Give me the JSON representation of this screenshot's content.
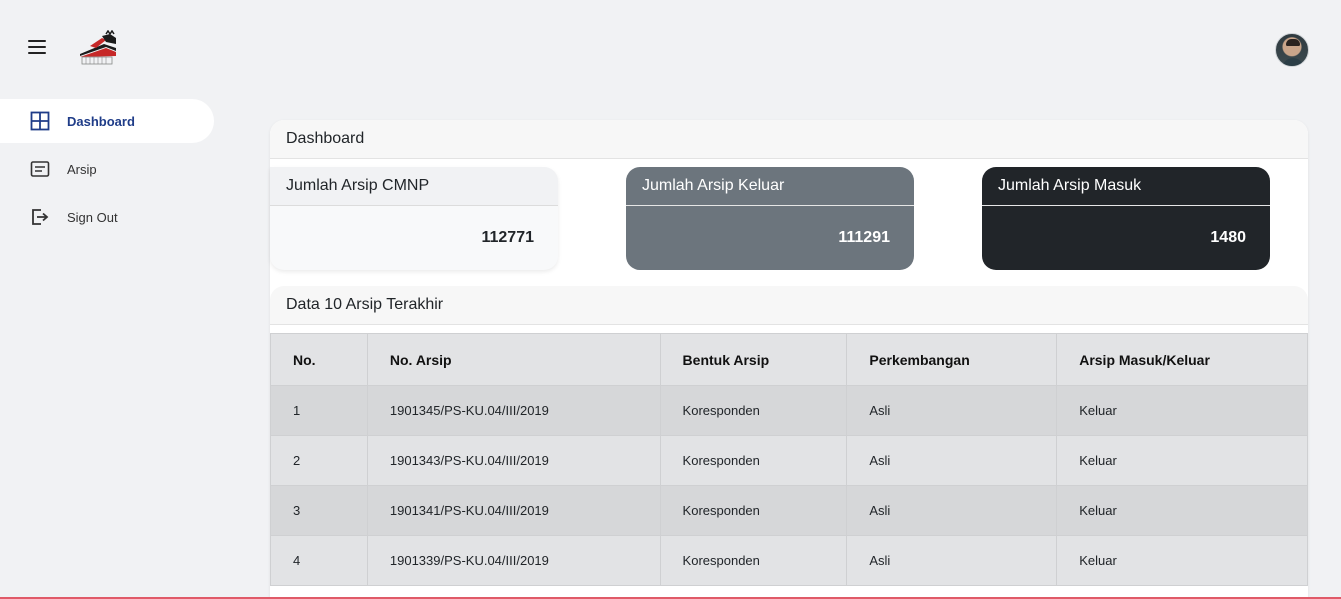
{
  "header": {
    "menu_icon": "hamburger-icon",
    "logo": "cmnp-logo",
    "avatar": "user-avatar"
  },
  "sidebar": {
    "items": [
      {
        "label": "Dashboard",
        "icon": "grid-icon",
        "active": true
      },
      {
        "label": "Arsip",
        "icon": "document-icon",
        "active": false
      },
      {
        "label": "Sign Out",
        "icon": "sign-out-icon",
        "active": false
      }
    ]
  },
  "main": {
    "title": "Dashboard",
    "cards": [
      {
        "title": "Jumlah Arsip CMNP",
        "value": "112771"
      },
      {
        "title": "Jumlah Arsip Keluar",
        "value": "111291"
      },
      {
        "title": "Jumlah Arsip Masuk",
        "value": "1480"
      }
    ],
    "recent": {
      "title": "Data 10 Arsip Terakhir",
      "columns": [
        "No.",
        "No. Arsip",
        "Bentuk Arsip",
        "Perkembangan",
        "Arsip Masuk/Keluar"
      ],
      "rows": [
        [
          "1",
          "1901345/PS-KU.04/III/2019",
          "Koresponden",
          "Asli",
          "Keluar"
        ],
        [
          "2",
          "1901343/PS-KU.04/III/2019",
          "Koresponden",
          "Asli",
          "Keluar"
        ],
        [
          "3",
          "1901341/PS-KU.04/III/2019",
          "Koresponden",
          "Asli",
          "Keluar"
        ],
        [
          "4",
          "1901339/PS-KU.04/III/2019",
          "Koresponden",
          "Asli",
          "Keluar"
        ]
      ]
    }
  },
  "colors": {
    "accent": "#1f3c88",
    "card_gray": "#6c757d",
    "card_dark": "#212529"
  }
}
